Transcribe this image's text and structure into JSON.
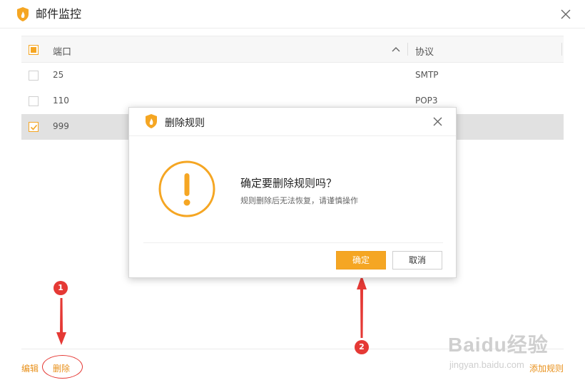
{
  "window": {
    "title": "邮件监控"
  },
  "table": {
    "header": {
      "port": "端口",
      "protocol": "协议"
    },
    "rows": [
      {
        "port": "25",
        "protocol": "SMTP",
        "checked": false
      },
      {
        "port": "110",
        "protocol": "POP3",
        "checked": false
      },
      {
        "port": "999",
        "protocol": "",
        "checked": true
      }
    ]
  },
  "footer": {
    "edit": "编辑",
    "delete": "删除",
    "add_rule": "添加规则"
  },
  "dialog": {
    "title": "删除规则",
    "question": "确定要删除规则吗？",
    "subtext": "规则删除后无法恢复，请谨慎操作",
    "ok": "确定",
    "cancel": "取消",
    "icon": "warning-icon"
  },
  "annotations": {
    "marker1": "1",
    "marker2": "2"
  },
  "watermark": {
    "brand": "Baidu经验",
    "url": "jingyan.baidu.com"
  },
  "colors": {
    "accent": "#f5a623",
    "link": "#e8911c",
    "annotation": "#e53935",
    "selected_row": "#e1e1e1"
  }
}
